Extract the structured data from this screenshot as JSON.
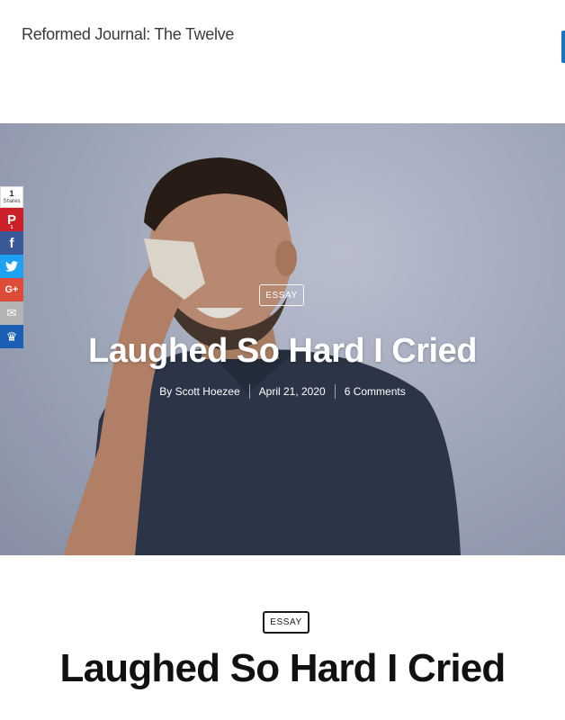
{
  "site": {
    "title": "Reformed Journal: The Twelve"
  },
  "share_bar": {
    "count": "1",
    "count_label": "Shares",
    "buttons": [
      {
        "name": "pinterest",
        "glyph": "P",
        "mini": "1",
        "color": "#cb2027"
      },
      {
        "name": "facebook",
        "glyph": "f",
        "mini": "",
        "color": "#3b5998"
      },
      {
        "name": "twitter",
        "glyph": "🐦",
        "mini": "",
        "color": "#1da1f2"
      },
      {
        "name": "google-plus",
        "glyph": "G+",
        "mini": "",
        "color": "#dd4b39"
      },
      {
        "name": "email",
        "glyph": "✉",
        "mini": "",
        "color": "#b3b3b3"
      },
      {
        "name": "sumome",
        "glyph": "♛",
        "mini": "",
        "color": "#1a5fb4"
      }
    ]
  },
  "hero": {
    "category": "ESSAY",
    "title": "Laughed So Hard I Cried",
    "author": "By Scott Hoezee",
    "date": "April 21, 2020",
    "comments": "6 Comments"
  },
  "post": {
    "category": "ESSAY",
    "title": "Laughed So Hard I Cried"
  }
}
